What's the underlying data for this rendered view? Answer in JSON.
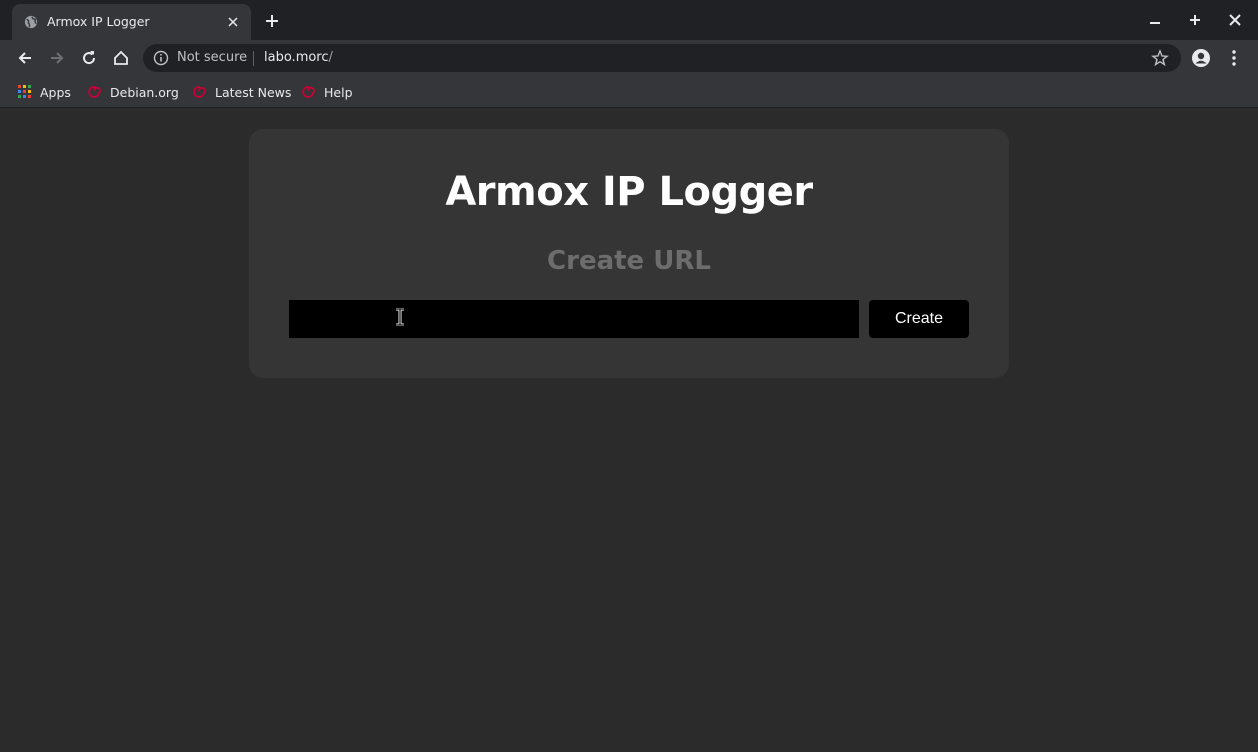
{
  "browser": {
    "tab": {
      "title": "Armox IP Logger",
      "favicon": "globe-icon"
    },
    "window_controls": [
      "minimize-icon",
      "maximize-icon",
      "close-icon"
    ],
    "toolbar": {
      "security_label": "Not secure",
      "url_host": "labo.morc",
      "url_path": "/"
    },
    "bookmarks": [
      {
        "label": "Apps",
        "icon": "apps-grid-icon"
      },
      {
        "label": "Debian.org",
        "icon": "debian-swirl-icon"
      },
      {
        "label": "Latest News",
        "icon": "debian-swirl-icon"
      },
      {
        "label": "Help",
        "icon": "debian-swirl-icon"
      }
    ]
  },
  "page": {
    "title": "Armox IP Logger",
    "subtitle": "Create URL",
    "url_input": {
      "value": "",
      "placeholder": ""
    },
    "create_button": "Create"
  },
  "colors": {
    "page_bg": "#2b2b2b",
    "card_bg": "#353535",
    "subtitle": "#6d6d6d",
    "input_bg": "#000000",
    "debian_red": "#c70036"
  }
}
